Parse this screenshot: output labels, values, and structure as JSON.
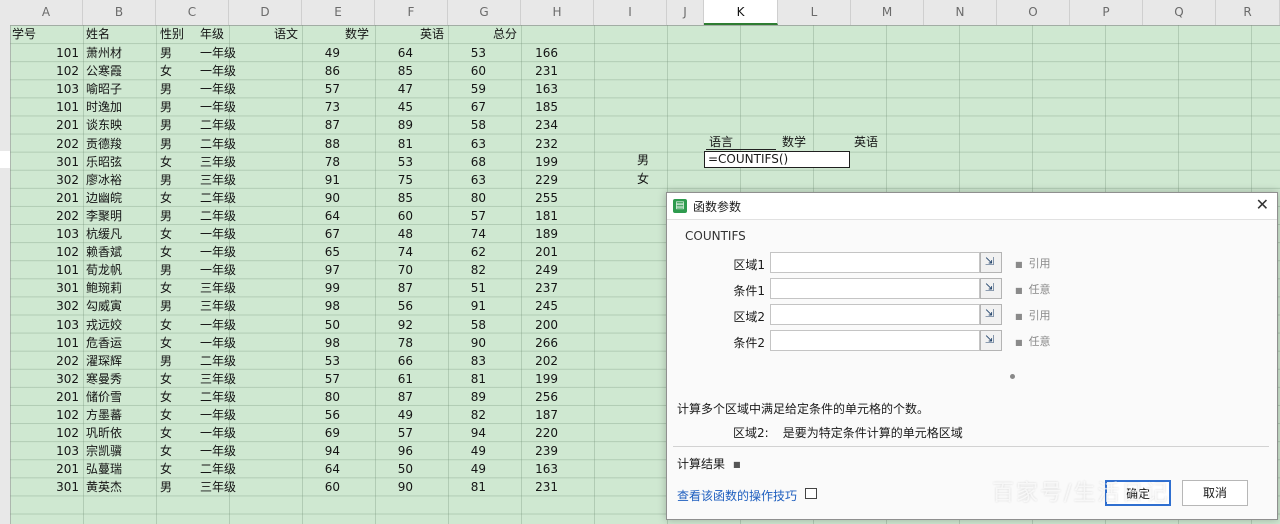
{
  "columns": [
    "A",
    "B",
    "C",
    "D",
    "E",
    "F",
    "G",
    "H",
    "I",
    "J",
    "K",
    "L",
    "M",
    "N",
    "O",
    "P",
    "Q",
    "R"
  ],
  "active_column": "K",
  "table": {
    "headers": [
      "学号",
      "姓名",
      "性别",
      "年级",
      "语文",
      "数学",
      "英语",
      "总分"
    ],
    "rows": [
      [
        "101",
        "萧州材",
        "男",
        "一年级",
        "49",
        "64",
        "53",
        "166"
      ],
      [
        "102",
        "公寒霞",
        "女",
        "一年级",
        "86",
        "85",
        "60",
        "231"
      ],
      [
        "103",
        "喻昭子",
        "男",
        "一年级",
        "57",
        "47",
        "59",
        "163"
      ],
      [
        "101",
        "时逸加",
        "男",
        "一年级",
        "73",
        "45",
        "67",
        "185"
      ],
      [
        "201",
        "谈东映",
        "男",
        "二年级",
        "87",
        "89",
        "58",
        "234"
      ],
      [
        "202",
        "贡德羧",
        "男",
        "二年级",
        "88",
        "81",
        "63",
        "232"
      ],
      [
        "301",
        "乐昭弦",
        "女",
        "三年级",
        "78",
        "53",
        "68",
        "199"
      ],
      [
        "302",
        "廖冰裕",
        "男",
        "三年级",
        "91",
        "75",
        "63",
        "229"
      ],
      [
        "201",
        "边幽皖",
        "女",
        "二年级",
        "90",
        "85",
        "80",
        "255"
      ],
      [
        "202",
        "李聚明",
        "男",
        "二年级",
        "64",
        "60",
        "57",
        "181"
      ],
      [
        "103",
        "杭缓凡",
        "女",
        "一年级",
        "67",
        "48",
        "74",
        "189"
      ],
      [
        "102",
        "赖香斌",
        "女",
        "一年级",
        "65",
        "74",
        "62",
        "201"
      ],
      [
        "101",
        "荀龙帆",
        "男",
        "一年级",
        "97",
        "70",
        "82",
        "249"
      ],
      [
        "301",
        "鲍琬莉",
        "女",
        "三年级",
        "99",
        "87",
        "51",
        "237"
      ],
      [
        "302",
        "勾威寅",
        "男",
        "三年级",
        "98",
        "56",
        "91",
        "245"
      ],
      [
        "103",
        "戎远姣",
        "女",
        "一年级",
        "50",
        "92",
        "58",
        "200"
      ],
      [
        "101",
        "危香运",
        "女",
        "一年级",
        "98",
        "78",
        "90",
        "266"
      ],
      [
        "202",
        "濯琛辉",
        "男",
        "二年级",
        "53",
        "66",
        "83",
        "202"
      ],
      [
        "302",
        "寒曼秀",
        "女",
        "三年级",
        "57",
        "61",
        "81",
        "199"
      ],
      [
        "201",
        "储价雪",
        "女",
        "二年级",
        "80",
        "87",
        "89",
        "256"
      ],
      [
        "102",
        "方墨蕃",
        "女",
        "一年级",
        "56",
        "49",
        "82",
        "187"
      ],
      [
        "102",
        "巩昕依",
        "女",
        "一年级",
        "69",
        "57",
        "94",
        "220"
      ],
      [
        "103",
        "宗凯骥",
        "女",
        "一年级",
        "94",
        "96",
        "49",
        "239"
      ],
      [
        "201",
        "弘蔓瑞",
        "女",
        "二年级",
        "64",
        "50",
        "49",
        "163"
      ],
      [
        "301",
        "黄英杰",
        "男",
        "三年级",
        "60",
        "90",
        "81",
        "231"
      ]
    ]
  },
  "summary": {
    "headers": [
      "语言",
      "数学",
      "英语"
    ],
    "row_labels": [
      "男",
      "女"
    ],
    "formula": "=COUNTIFS()"
  },
  "dialog": {
    "title": "函数参数",
    "function_name": "COUNTIFS",
    "params": [
      {
        "label": "区域1",
        "hint": "引用"
      },
      {
        "label": "条件1",
        "hint": "任意"
      },
      {
        "label": "区域2",
        "hint": "引用"
      },
      {
        "label": "条件2",
        "hint": "任意"
      }
    ],
    "description": "计算多个区域中满足给定条件的单元格的个数。",
    "param_desc_label": "区域2:",
    "param_desc_text": "是要为特定条件计算的单元格区域",
    "result_label": "计算结果",
    "help_link": "查看该函数的操作技巧",
    "ok_label": "确定",
    "cancel_label": "取消"
  },
  "watermark": "百家号/生活日记",
  "colors": {
    "sheet_bg": "#cfe8d1",
    "header_bg": "#e8e8e8",
    "ok_border": "#2f6fd0",
    "link": "#1f5fbf",
    "app_icon": "#2e9b4e"
  }
}
